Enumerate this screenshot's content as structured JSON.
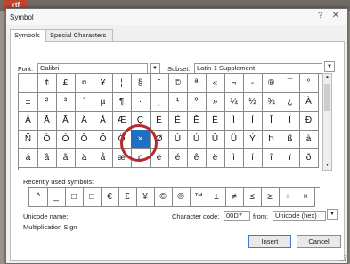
{
  "background": {
    "tab_label": "rtf"
  },
  "dialog": {
    "title": "Symbol",
    "help_glyph": "?",
    "close_glyph": "✕"
  },
  "tabs": {
    "symbols": "Symbols",
    "special": "Special Characters"
  },
  "font": {
    "label": "Font:",
    "value": "Calibri"
  },
  "subset": {
    "label": "Subset:",
    "value": "Latin-1 Supplement"
  },
  "symbol_grid": {
    "rows": [
      [
        "¡",
        "¢",
        "£",
        "¤",
        "¥",
        "¦",
        "§",
        "¨",
        "©",
        "ª",
        "«",
        "¬",
        "-",
        "®",
        "¯",
        "°"
      ],
      [
        "±",
        "²",
        "³",
        "´",
        "µ",
        "¶",
        "·",
        "¸",
        "¹",
        "º",
        "»",
        "¼",
        "½",
        "¾",
        "¿",
        "À"
      ],
      [
        "Á",
        "Â",
        "Ã",
        "Ä",
        "Å",
        "Æ",
        "Ç",
        "È",
        "É",
        "Ê",
        "Ë",
        "Ì",
        "Í",
        "Î",
        "Ï",
        "Ð"
      ],
      [
        "Ñ",
        "Ò",
        "Ó",
        "Ô",
        "Õ",
        "Ö",
        "×",
        "Ø",
        "Ù",
        "Ú",
        "Û",
        "Ü",
        "Ý",
        "Þ",
        "ß",
        "à"
      ],
      [
        "á",
        "â",
        "ã",
        "ä",
        "å",
        "æ",
        "ç",
        "è",
        "é",
        "ê",
        "ë",
        "ì",
        "í",
        "î",
        "ï",
        "ð"
      ]
    ],
    "selected": {
      "row": 3,
      "col": 6
    }
  },
  "recent": {
    "label": "Recently used symbols:",
    "items": [
      "^",
      "_",
      "□",
      "□",
      "€",
      "£",
      "¥",
      "©",
      "®",
      "™",
      "±",
      "≠",
      "≤",
      "≥",
      "÷",
      "×"
    ]
  },
  "unicode_name": {
    "label": "Unicode name:",
    "value": "Multiplication Sign"
  },
  "char_code": {
    "label": "Character code:",
    "value": "00D7"
  },
  "from": {
    "label": "from:",
    "value": "Unicode (hex)"
  },
  "buttons": {
    "insert": "Insert",
    "cancel": "Cancel"
  }
}
